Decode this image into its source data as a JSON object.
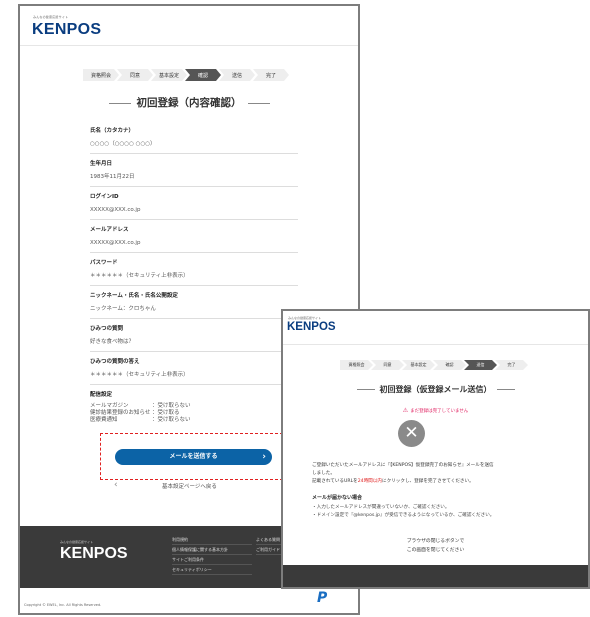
{
  "brand": {
    "tagline": "みんなの健康応援サイト",
    "logo": "KENPOS"
  },
  "steps": [
    "資格照会",
    "同意",
    "基本設定",
    "確認",
    "送信",
    "完了"
  ],
  "confirm_page": {
    "title": "初回登録（内容確認）",
    "active_step": "確認",
    "fields": [
      {
        "label": "氏名（カタカナ）",
        "value": "○○○○（○○○○ ○○○）"
      },
      {
        "label": "生年月日",
        "value": "1983年11月22日"
      },
      {
        "label": "ログインID",
        "value": "XXXXX@XXX.co.jp"
      },
      {
        "label": "メールアドレス",
        "value": "XXXXX@XXX.co.jp"
      },
      {
        "label": "パスワード",
        "value": "＊＊＊＊＊＊（セキュリティ上非表示）"
      },
      {
        "label": "ニックネーム・氏名・氏名公開設定",
        "value": "ニックネーム：クロちゃん"
      },
      {
        "label": "ひみつの質問",
        "value": "好きな食べ物は？"
      },
      {
        "label": "ひみつの質問の答え",
        "value": "＊＊＊＊＊＊（セキュリティ上非表示）"
      }
    ],
    "delivery": {
      "label": "配信設定",
      "rows": [
        {
          "name": "メールマガジン",
          "value": "：受け取らない"
        },
        {
          "name": "健診結果登録のお知らせ",
          "value": "：受け取る"
        },
        {
          "name": "医療費通知",
          "value": "：受け取らない"
        }
      ]
    },
    "send_button": "メールを送信する",
    "send_arrow": "›",
    "back_link": "基本設定ページへ戻る",
    "back_chevron": "‹",
    "footer_links": [
      "利用規約",
      "個人情報保護に関する基本方針",
      "サイトご利用条件",
      "セキュリティポリシー"
    ],
    "footer_links2": [
      "よくある質問",
      "ご利用ガイド"
    ],
    "copyright": "Copyright © EWEL, Inc. All Rights Reserved.",
    "badge": "P"
  },
  "sent_page": {
    "title": "初回登録（仮登録メール送信）",
    "active_step": "送信",
    "warning": "まだ登録は完了していません",
    "warning_icon": "⚠",
    "status_icon": "✕",
    "body_line1": "ご登録いただいたメールアドレスに『【KENPOS】仮登録完了のお知らせ』メールを送信",
    "body_line2": "しました。",
    "body_line3_pre": "記載されているURLを",
    "body_line3_highlight": "24時間以内",
    "body_line3_post": "にクリックし、登録を完了させてください。",
    "nomail_heading": "メールが届かない場合",
    "nomail_items": [
      "・入力したメールアドレスが間違っていないか、ご確認ください。",
      "・ドメイン設定で『@kenpos.jp』が受信できるようになっているか、ご確認ください。"
    ],
    "close_line1": "ブラウザの閉じるボタンで",
    "close_line2": "この画面を閉じてください"
  },
  "colors": {
    "logo": "#0a3d80",
    "button": "#0c63a6",
    "highlight_box": "#e02020",
    "warning": "#e02060",
    "footer": "#3a3a3a"
  }
}
